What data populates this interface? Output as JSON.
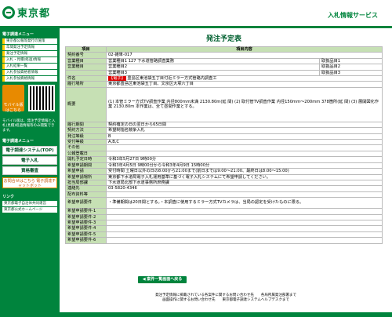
{
  "header": {
    "logo_text": "東京都",
    "service": "入札情報サービス"
  },
  "sidebar": {
    "menu_heading": "電子調達メニュー",
    "items": [
      "東京都公報等発行の施策",
      "年間発注予定情報",
      "発注予定情報",
      "入札・見積(経過)情報",
      "入札結果一覧",
      "入札参加資格者情報",
      "入札参加資格情報"
    ],
    "mobile_btn": "モバイル版はこちら",
    "mobile_note": "モバイル版は、発注予定情報と入札(見積)経過情報等のみ閲覧できます。",
    "other_heading": "電子調達メニュー",
    "buttons": [
      "電子調達システム(TOP)",
      "電子入札",
      "資格審査"
    ],
    "faq": "お問合せはこちら 電子調達チャットボット",
    "links_heading": "リンク",
    "links": [
      "東京都電子自治体共同運営",
      "東京都公式ホームページ"
    ]
  },
  "main": {
    "title": "発注予定表",
    "head": {
      "c1": "項目",
      "c2": "項目内容"
    },
    "rows": [
      {
        "k": "契約番号",
        "v": "02-雑単-017"
      },
      {
        "k": "営業種目",
        "v": "営業種目1 127 下水道管路調査業務",
        "extra": "取扱品目1"
      },
      {
        "k": "営業種目",
        "v": "営業種目2",
        "extra": "取扱品目2"
      },
      {
        "k": "",
        "v": "営業種目3",
        "extra": "取扱品目3"
      },
      {
        "k": "件名",
        "tag": "【電子】",
        "v": "豊島区東池袋五丁目付近ミラー方式管路内調査工"
      },
      {
        "k": "履行場所",
        "v": "東京都豊島区東池袋五丁目、文京区大塚六丁目"
      },
      {
        "k": "概要",
        "v": "(1) 本管ミラー方式TV調査作業 内径800mm未満 2130.80m(延 間) (2) 取付管TV調査作業 内径150mm〜200mm 378箇所(延 間) (3) 展開図化作業 2130.80m 本作業は、全て昼間作業とする。"
      },
      {
        "k": "履行期間",
        "v": "契約確定の日の翌日から65日間"
      },
      {
        "k": "契約方法",
        "v": "希望制指名競争入札"
      },
      {
        "k": "発注等級",
        "v": "B"
      },
      {
        "k": "受付等級",
        "v": "A,B,C"
      },
      {
        "k": "その他",
        "v": ""
      },
      {
        "k": "公報登載日",
        "v": ""
      },
      {
        "k": "開札予定日時",
        "v": "令和3年5月27日 9時00分"
      },
      {
        "k": "希望申請期間",
        "v": "令和3年4月5日 9時00分から令和3年4月9日 15時00分"
      },
      {
        "k": "希望申請",
        "v": "受付時間 土曜日以外の日の8:00から21:00まで(前日までは9:00〜21:00、最終日は8:00〜15:00)"
      },
      {
        "k": "希望申請場所",
        "v": "東京都下水道局電子入札運用基準に基づく電子入札システムにて希望申請してください。"
      },
      {
        "k": "担当局部課",
        "v": "下水道局北部下水道事務所庶務課"
      },
      {
        "k": "連絡先",
        "v": "03-5820-4346"
      },
      {
        "k": "配布資料等",
        "v": ""
      },
      {
        "k": "希望申請要件",
        "v": "・準備期間は20日間とする。・本調査に使用するミラー方式TVカメラは、当局の認定を受けたものに限る。"
      },
      {
        "k": "希望申請要件-1",
        "v": ""
      },
      {
        "k": "希望申請要件-2",
        "v": ""
      },
      {
        "k": "希望申請要件-3",
        "v": ""
      },
      {
        "k": "希望申請要件-4",
        "v": ""
      },
      {
        "k": "希望申請要件-5",
        "v": ""
      },
      {
        "k": "希望申請要件-6",
        "v": ""
      }
    ],
    "back_btn": "案件一覧画面へ戻る"
  },
  "footer": {
    "line1": "発注予定情報に掲載されている各案件に関するお問い合わせ先　　各局所属発注部署まで",
    "line2": "画面操作に関するお問い合わせ先　　東京都電子調達システムヘルプデスクまで"
  }
}
